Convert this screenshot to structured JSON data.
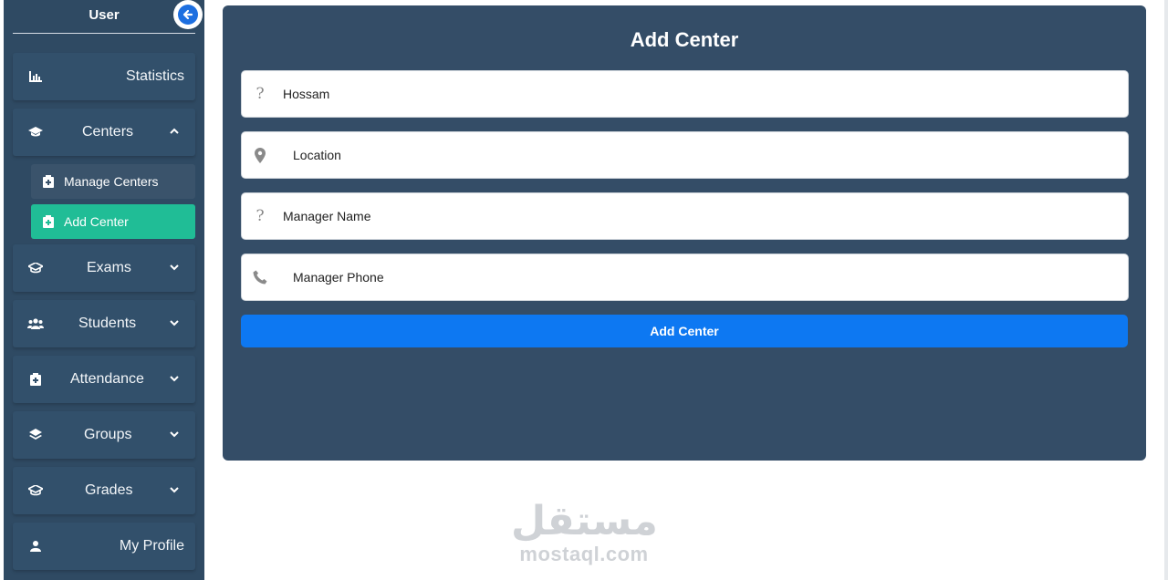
{
  "sidebar": {
    "user_label": "User",
    "items": [
      {
        "label": "Statistics",
        "icon": "bar-chart-icon"
      },
      {
        "label": "Centers",
        "icon": "graduation-cap-icon",
        "expanded": true,
        "subitems": [
          {
            "label": "Manage Centers",
            "icon": "clipboard-icon"
          },
          {
            "label": "Add Center",
            "icon": "clipboard-icon",
            "active": true
          }
        ]
      },
      {
        "label": "Exams",
        "icon": "graduation-cap-icon"
      },
      {
        "label": "Students",
        "icon": "users-icon"
      },
      {
        "label": "Attendance",
        "icon": "clipboard-icon"
      },
      {
        "label": "Groups",
        "icon": "layers-icon"
      },
      {
        "label": "Grades",
        "icon": "graduation-cap-icon"
      },
      {
        "label": "My Profile",
        "icon": "user-icon"
      }
    ]
  },
  "form": {
    "title": "Add Center",
    "fields": [
      {
        "value": "Hossam",
        "icon": "unknown-icon"
      },
      {
        "value": "Location",
        "icon": "map-pin-icon"
      },
      {
        "value": "Manager Name",
        "icon": "unknown-icon"
      },
      {
        "value": "Manager Phone",
        "icon": "phone-icon"
      }
    ],
    "submit_label": "Add Center",
    "icon_fallback_glyph": "?"
  },
  "watermark": {
    "arabic": "مستقل",
    "latin": "mostaql.com"
  },
  "colors": {
    "sidebar_bg": "#2f4a63",
    "card_bg": "#344d67",
    "active_item": "#20bd96",
    "primary_button": "#0d78f2"
  }
}
